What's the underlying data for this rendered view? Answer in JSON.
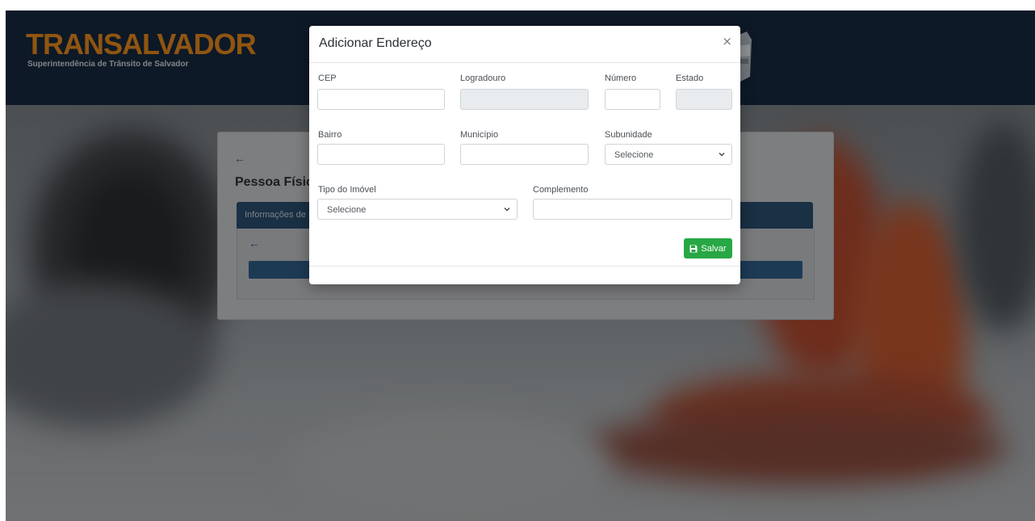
{
  "header": {
    "logo_title": "TRANSALVADOR",
    "logo_subtitle": "Superintendência de Trânsito de Salvador"
  },
  "card": {
    "back_icon": "arrow-left-icon",
    "page_title": "Pessoa Físic",
    "tab_label": "Informações de",
    "inner_back_icon": "arrow-left-icon"
  },
  "modal": {
    "title": "Adicionar Endereço",
    "close_symbol": "×",
    "fields": {
      "cep": {
        "label": "CEP",
        "value": ""
      },
      "logradouro": {
        "label": "Logradouro",
        "value": ""
      },
      "numero": {
        "label": "Número",
        "value": ""
      },
      "estado": {
        "label": "Estado",
        "value": ""
      },
      "bairro": {
        "label": "Bairro",
        "value": ""
      },
      "municipio": {
        "label": "Município",
        "value": ""
      },
      "subunidade": {
        "label": "Subunidade",
        "selected": "Selecione"
      },
      "tipo_imovel": {
        "label": "Tipo do Imóvel",
        "selected": "Selecione"
      },
      "complemento": {
        "label": "Complemento",
        "value": ""
      }
    },
    "save_label": "Salvar"
  },
  "colors": {
    "header_bg": "#16293e",
    "logo_orange": "#e8891c",
    "save_green": "#28a745",
    "tab_blue": "#2a4e6e"
  }
}
